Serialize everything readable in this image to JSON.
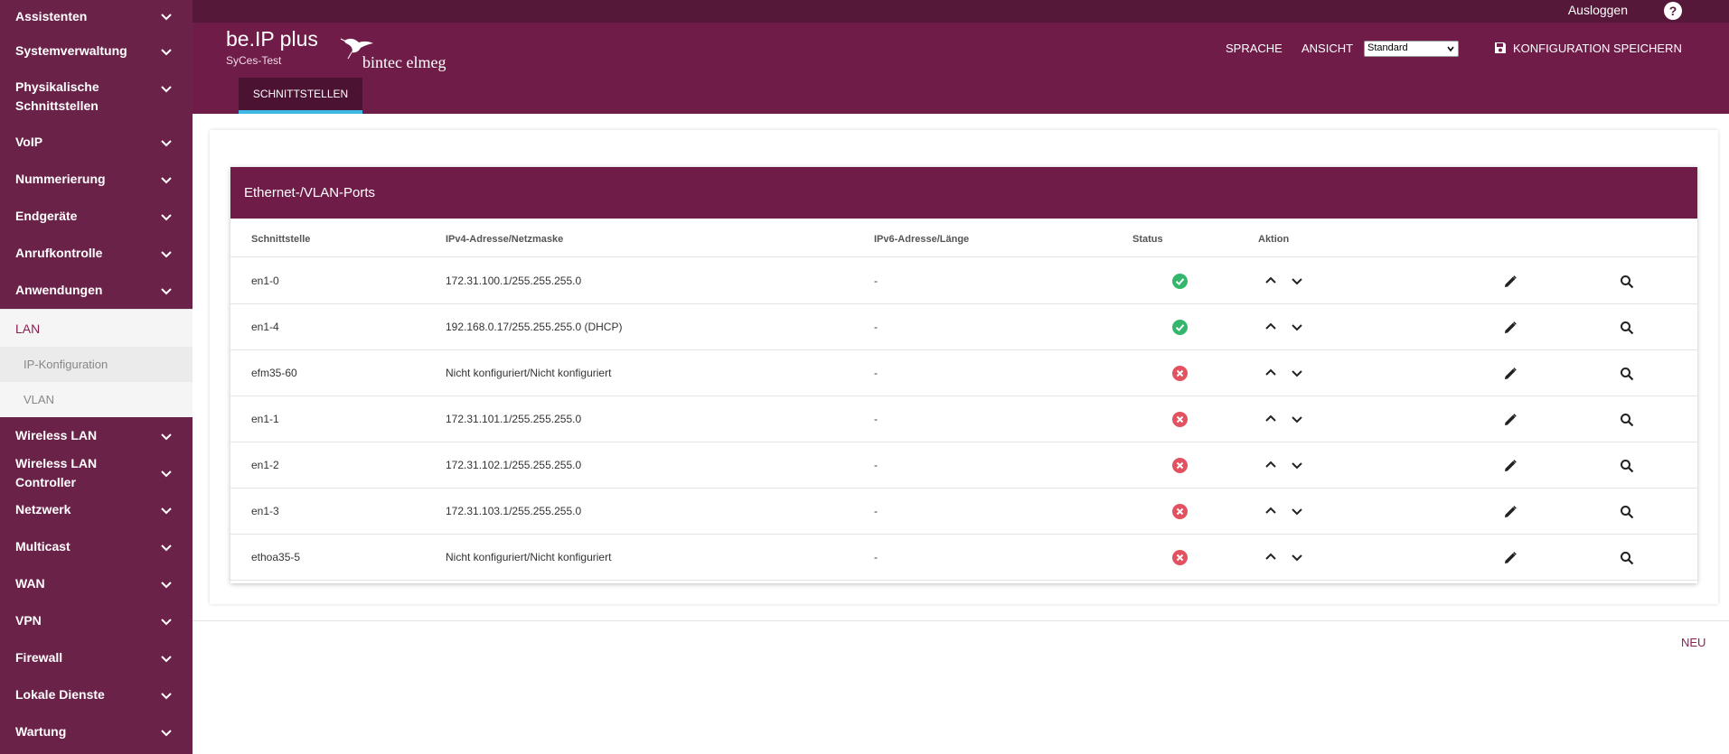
{
  "sidebar": {
    "items_top": [
      {
        "label": "Assistenten"
      },
      {
        "label": "Systemverwaltung"
      },
      {
        "label": "Physikalische Schnittstellen"
      },
      {
        "label": "VoIP"
      },
      {
        "label": "Nummerierung"
      },
      {
        "label": "Endgeräte"
      },
      {
        "label": "Anrufkontrolle"
      },
      {
        "label": "Anwendungen"
      }
    ],
    "expanded": {
      "label": "LAN",
      "sub_items": [
        {
          "label": "IP-Konfiguration",
          "active": true
        },
        {
          "label": "VLAN",
          "active": false
        }
      ]
    },
    "items_bottom": [
      {
        "label": "Wireless LAN"
      },
      {
        "label": "Wireless LAN Controller"
      },
      {
        "label": "Netzwerk"
      },
      {
        "label": "Multicast"
      },
      {
        "label": "WAN"
      },
      {
        "label": "VPN"
      },
      {
        "label": "Firewall"
      },
      {
        "label": "Lokale Dienste"
      },
      {
        "label": "Wartung"
      }
    ]
  },
  "topbar": {
    "logout_label": "Ausloggen",
    "help_label": "?"
  },
  "header": {
    "app_title": "be.IP plus",
    "device_name": "SyCes-Test",
    "brand": "bintec elmeg",
    "language_label": "SPRACHE",
    "view_label": "ANSICHT",
    "view_selected": "Standard",
    "save_label": "KONFIGURATION SPEICHERN",
    "tab_label": "SCHNITTSTELLEN"
  },
  "table": {
    "title": "Ethernet-/VLAN-Ports",
    "columns": {
      "iface": "Schnittstelle",
      "ipv4": "IPv4-Adresse/Netzmaske",
      "ipv6": "IPv6-Adresse/Länge",
      "status": "Status",
      "action": "Aktion"
    },
    "rows": [
      {
        "iface": "en1-0",
        "ipv4": "172.31.100.1/255.255.255.0",
        "ipv6": "-",
        "status": "ok"
      },
      {
        "iface": "en1-4",
        "ipv4": "192.168.0.17/255.255.255.0  (DHCP)",
        "ipv6": "-",
        "status": "ok"
      },
      {
        "iface": "efm35-60",
        "ipv4": "Nicht konfiguriert/Nicht konfiguriert",
        "ipv6": "-",
        "status": "error"
      },
      {
        "iface": "en1-1",
        "ipv4": "172.31.101.1/255.255.255.0",
        "ipv6": "-",
        "status": "error"
      },
      {
        "iface": "en1-2",
        "ipv4": "172.31.102.1/255.255.255.0",
        "ipv6": "-",
        "status": "error"
      },
      {
        "iface": "en1-3",
        "ipv4": "172.31.103.1/255.255.255.0",
        "ipv6": "-",
        "status": "error"
      },
      {
        "iface": "ethoa35-5",
        "ipv4": "Nicht konfiguriert/Nicht konfiguriert",
        "ipv6": "-",
        "status": "error"
      }
    ]
  },
  "footer": {
    "new_label": "NEU"
  },
  "colors": {
    "sidebar": "#6b2248",
    "header": "#6f1c48",
    "topbar": "#561838",
    "tab_indicator": "#3fb8e6",
    "status_ok": "#34b76d",
    "status_error": "#e25260",
    "accent_text": "#8a1f52"
  }
}
